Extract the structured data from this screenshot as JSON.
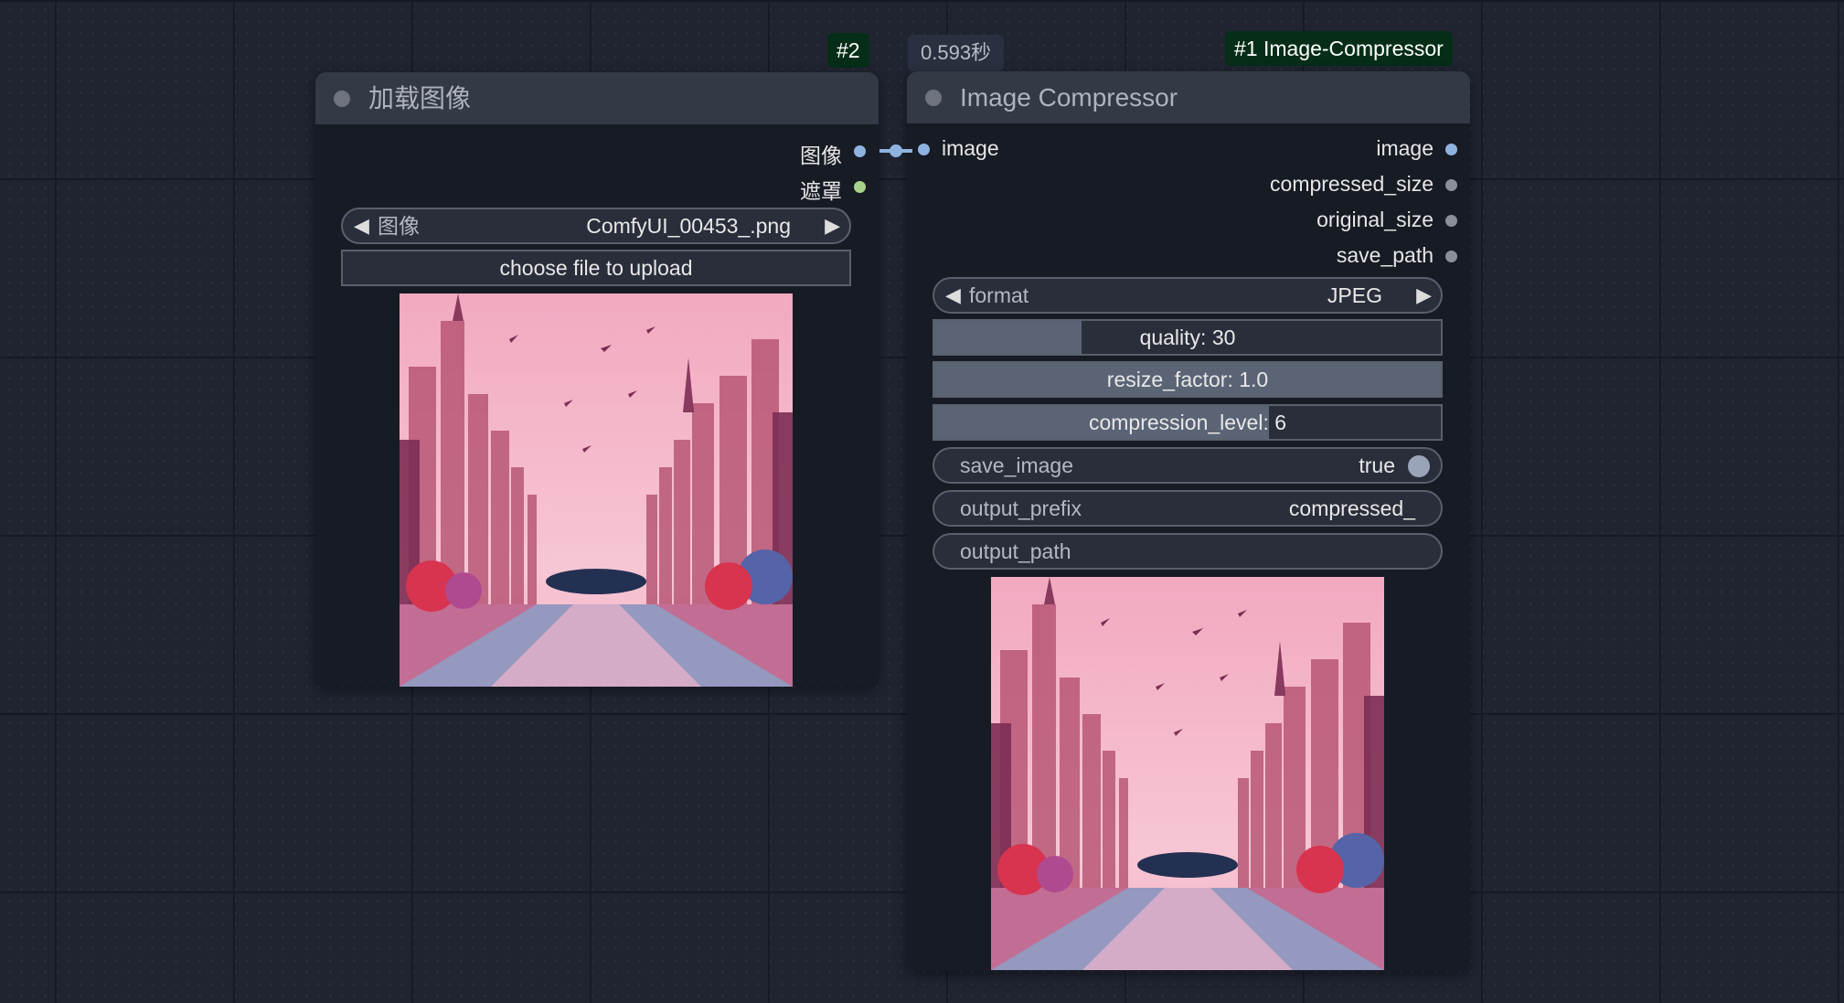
{
  "load_image_node": {
    "badge": "#2",
    "title": "加载图像",
    "outputs": [
      "图像",
      "遮罩"
    ],
    "image_combo": {
      "label": "图像",
      "value": "ComfyUI_00453_.png"
    },
    "upload_button": "choose file to upload"
  },
  "compressor_node": {
    "exec_time": "0.593秒",
    "badge": "#1 Image-Compressor",
    "title": "Image Compressor",
    "input": "image",
    "outputs": [
      "image",
      "compressed_size",
      "original_size",
      "save_path"
    ],
    "format": {
      "label": "format",
      "value": "JPEG"
    },
    "quality": {
      "text": "quality: 30",
      "fill": 0.29
    },
    "resize_factor": {
      "text": "resize_factor: 1.0",
      "fill": 1.0
    },
    "compression_level": {
      "text": "compression_level: 6",
      "fill": 0.66
    },
    "save_image": {
      "label": "save_image",
      "value": "true"
    },
    "output_prefix": {
      "label": "output_prefix",
      "value": "compressed_"
    },
    "output_path": {
      "label": "output_path",
      "value": ""
    }
  },
  "colors": {
    "image_slot": "#8fb3e0",
    "mask_slot": "#a8d28a",
    "other_slot": "#8b8f99",
    "badge_bg": "#062d17"
  }
}
